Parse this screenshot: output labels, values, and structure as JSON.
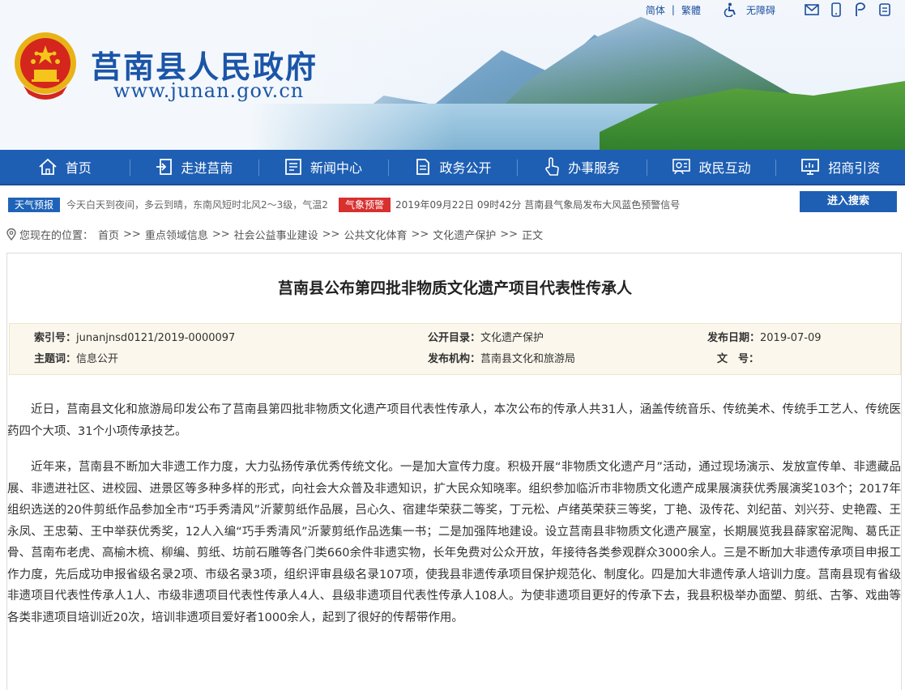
{
  "header": {
    "site_title": "莒南县人民政府",
    "site_url": "www.junan.gov.cn",
    "lang_simplified": "简体",
    "lang_sep": "|",
    "lang_traditional": "繁體",
    "accessibility": "无障碍"
  },
  "nav": {
    "items": [
      {
        "label": "首页",
        "icon": "home-icon"
      },
      {
        "label": "走进莒南",
        "icon": "enter-icon"
      },
      {
        "label": "新闻中心",
        "icon": "news-icon"
      },
      {
        "label": "政务公开",
        "icon": "document-icon"
      },
      {
        "label": "办事服务",
        "icon": "hand-pointer-icon"
      },
      {
        "label": "政民互动",
        "icon": "interaction-icon"
      },
      {
        "label": "招商引资",
        "icon": "monitor-icon"
      }
    ]
  },
  "infobar": {
    "weather_label": "天气预报",
    "weather_text": "今天白天到夜间，多云到晴，东南风短时北风2～3级，气温2",
    "warning_label": "气象预警",
    "warning_text": "2019年09月22日 09时42分  莒南县气象局发布大风蓝色预警信号",
    "search_button": "进入搜索"
  },
  "breadcrumb": {
    "prefix": "您现在的位置：",
    "items": [
      "首页",
      "重点领域信息",
      "社会公益事业建设",
      "公共文化体育",
      "文化遗产保护",
      "正文"
    ],
    "separator": ">>"
  },
  "article": {
    "title": "莒南县公布第四批非物质文化遗产项目代表性传承人",
    "meta": {
      "index_label": "索引号：",
      "index_value": "junanjnsd0121/2019-0000097",
      "catalog_label": "公开目录：",
      "catalog_value": "文化遗产保护",
      "date_label": "发布日期：",
      "date_value": "2019-07-09",
      "subject_label": "主题词：",
      "subject_value": "信息公开",
      "org_label": "发布机构：",
      "org_value": "莒南县文化和旅游局",
      "docno_label": "文　号："
    },
    "paragraphs": [
      "近日，莒南县文化和旅游局印发公布了莒南县第四批非物质文化遗产项目代表性传承人，本次公布的传承人共31人，涵盖传统音乐、传统美术、传统手工艺人、传统医药四个大项、31个小项传承技艺。",
      "近年来，莒南县不断加大非遗工作力度，大力弘扬传承优秀传统文化。一是加大宣传力度。积极开展“非物质文化遗产月”活动，通过现场演示、发放宣传单、非遗藏品展、非遗进社区、进校园、进景区等多种多样的形式，向社会大众普及非遗知识，扩大民众知晓率。组织参加临沂市非物质文化遗产成果展演获优秀展演奖103个；2017年组织选送的20件剪纸作品参加全市“巧手秀清风”沂蒙剪纸作品展，吕心久、宿建华荣获二等奖，丁元松、卢绪英荣获三等奖，丁艳、汲传花、刘纪苗、刘兴芬、史艳霞、王永凤、王忠菊、王中举获优秀奖，12人入编“巧手秀清风”沂蒙剪纸作品选集一书；二是加强阵地建设。设立莒南县非物质文化遗产展室，长期展览我县薛家窑泥陶、葛氏正骨、莒南布老虎、高榆木梳、柳编、剪纸、坊前石雕等各门类660余件非遗实物，长年免费对公众开放，年接待各类参观群众3000余人。三是不断加大非遗传承项目申报工作力度，先后成功申报省级名录2项、市级名录3项，组织评审县级名录107项，使我县非遗传承项目保护规范化、制度化。四是加大非遗传承人培训力度。莒南县现有省级非遗项目代表性传承人1人、市级非遗项目代表性传承人4人、县级非遗项目代表性传承人108人。为使非遗项目更好的传承下去，我县积极举办面塑、剪纸、古筝、戏曲等各类非遗项目培训近20次，培训非遗项目爱好者1000余人，起到了很好的传帮带作用。"
    ]
  },
  "colors": {
    "brand_blue": "#1e5fb3",
    "warning_red": "#d82f2f",
    "meta_bg": "#fbf7ec"
  }
}
